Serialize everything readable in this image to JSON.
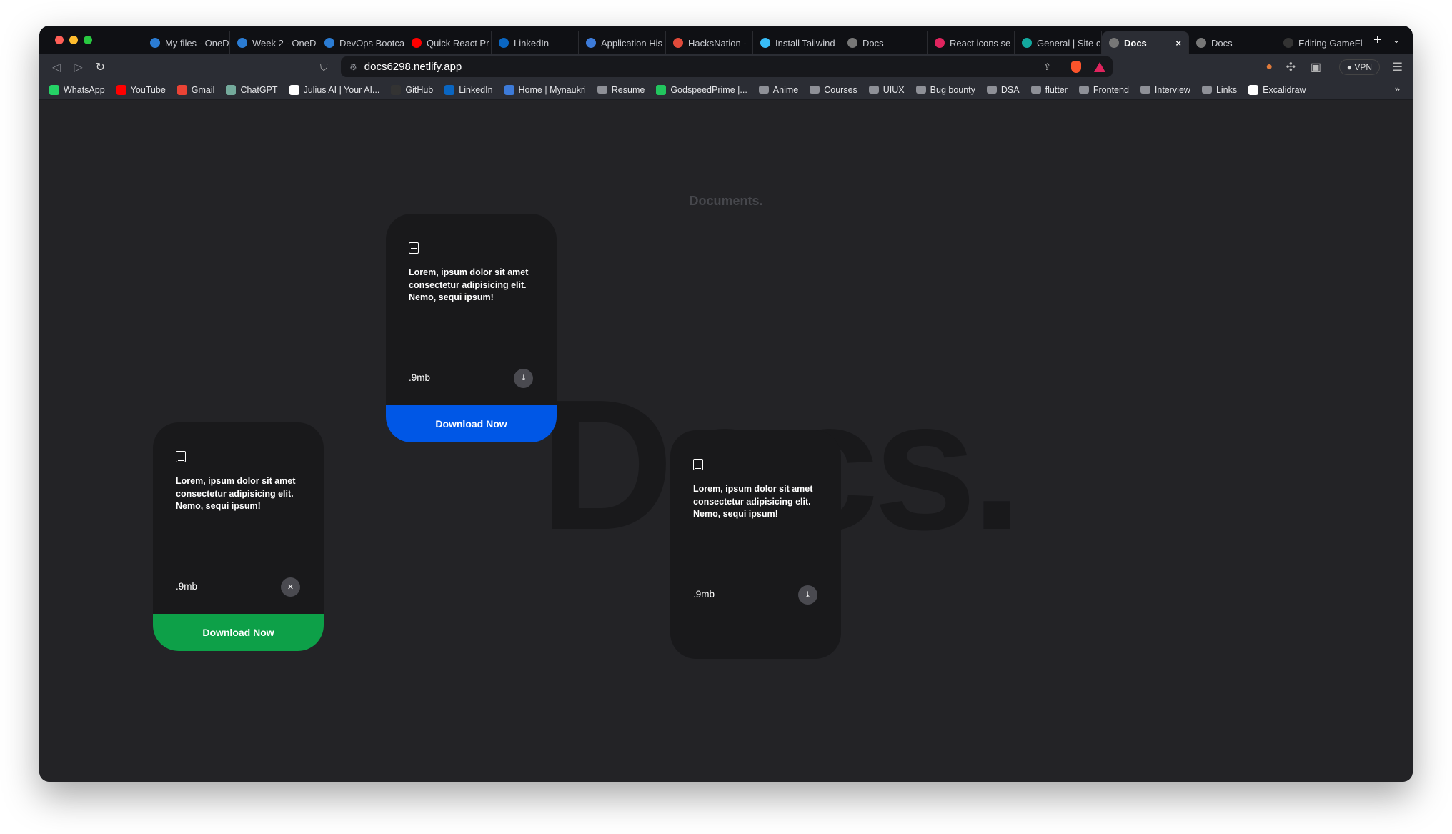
{
  "tabs": [
    {
      "label": "My files - OneD",
      "color": "#2b7cd3"
    },
    {
      "label": "Week 2 - OneD",
      "color": "#2b7cd3"
    },
    {
      "label": "DevOps Bootca",
      "color": "#2b7cd3"
    },
    {
      "label": "Quick React Pr",
      "color": "#ff0000"
    },
    {
      "label": "LinkedIn",
      "color": "#0a66c2"
    },
    {
      "label": "Application His",
      "color": "#3d7bd9"
    },
    {
      "label": "HacksNation -",
      "color": "#e04a3a"
    },
    {
      "label": "Install Tailwind",
      "color": "#38bdf8"
    },
    {
      "label": "Docs",
      "color": "#777"
    },
    {
      "label": "React icons se",
      "color": "#e0245e"
    },
    {
      "label": "General | Site c",
      "color": "#13a89e"
    },
    {
      "label": "Docs",
      "color": "#777",
      "active": true
    },
    {
      "label": "Docs",
      "color": "#777"
    },
    {
      "label": "Editing GameFl",
      "color": "#333"
    }
  ],
  "active_tab_close": "×",
  "new_tab": "+",
  "url": "docs6298.netlify.app",
  "vpn_label": "VPN",
  "bookmarks": [
    {
      "label": "WhatsApp",
      "color": "#25d366"
    },
    {
      "label": "YouTube",
      "color": "#ff0000"
    },
    {
      "label": "Gmail",
      "color": "#ea4335"
    },
    {
      "label": "ChatGPT",
      "color": "#74aa9c"
    },
    {
      "label": "Julius AI | Your AI...",
      "color": "#fff"
    },
    {
      "label": "GitHub",
      "color": "#333"
    },
    {
      "label": "LinkedIn",
      "color": "#0a66c2"
    },
    {
      "label": "Home | Mynaukri",
      "color": "#3d7bd9"
    },
    {
      "label": "Resume",
      "folder": true
    },
    {
      "label": "GodspeedPrime |...",
      "color": "#22c55e"
    },
    {
      "label": "Anime",
      "folder": true
    },
    {
      "label": "Courses",
      "folder": true
    },
    {
      "label": "UIUX",
      "folder": true
    },
    {
      "label": "Bug bounty",
      "folder": true
    },
    {
      "label": "DSA",
      "folder": true
    },
    {
      "label": "flutter",
      "folder": true
    },
    {
      "label": "Frontend",
      "folder": true
    },
    {
      "label": "Interview",
      "folder": true
    },
    {
      "label": "Links",
      "folder": true
    },
    {
      "label": "Excalidraw",
      "color": "#fff"
    }
  ],
  "bookmarks_more": "»",
  "page": {
    "label": "Documents.",
    "background_text": "Docs.",
    "cards": [
      {
        "text": "Lorem, ipsum dolor sit amet consectetur adipisicing elit. Nemo, sequi ipsum!",
        "size": ".9mb",
        "action": "download",
        "footer": "Download Now",
        "footer_color": "#0057e6"
      },
      {
        "text": "Lorem, ipsum dolor sit amet consectetur adipisicing elit. Nemo, sequi ipsum!",
        "size": ".9mb",
        "action": "close",
        "footer": "Download Now",
        "footer_color": "#0da048"
      },
      {
        "text": "Lorem, ipsum dolor sit amet consectetur adipisicing elit. Nemo, sequi ipsum!",
        "size": ".9mb",
        "action": "download"
      }
    ]
  }
}
